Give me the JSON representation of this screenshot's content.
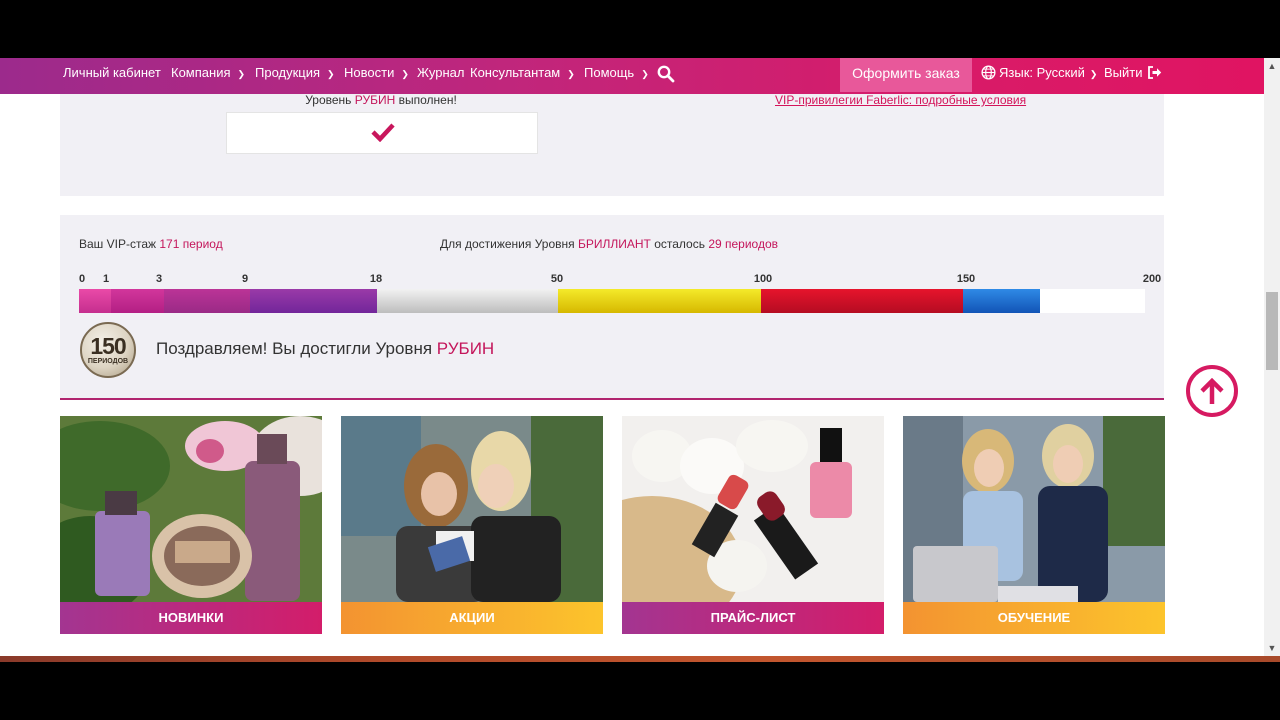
{
  "nav": {
    "items": [
      {
        "label": "Личный кабинет",
        "dropdown": false
      },
      {
        "label": "Компания",
        "dropdown": true
      },
      {
        "label": "Продукция",
        "dropdown": true
      },
      {
        "label": "Новости",
        "dropdown": true
      },
      {
        "label": "Журнал",
        "dropdown": false
      },
      {
        "label": "Консультантам",
        "dropdown": true
      },
      {
        "label": "Помощь",
        "dropdown": true
      }
    ],
    "order_button": "Оформить заказ",
    "language": "Язык: Русский",
    "logout": "Выйти"
  },
  "level_card": {
    "status_prefix": "Уровень ",
    "status_level": "РУБИН",
    "status_suffix": " выполнен!",
    "vip_link": "VIP-привилегии Faberlic: подробные условия"
  },
  "vip": {
    "stage_label": "Ваш VIP-стаж ",
    "stage_value": "171 период",
    "goal_prefix": "Для достижения Уровня ",
    "goal_level": "БРИЛЛИАНТ",
    "goal_middle": " осталось ",
    "goal_remaining": "29 периодов",
    "scale_max": 200,
    "current_periods": 171,
    "ticks": [
      0,
      1,
      3,
      9,
      18,
      50,
      100,
      150,
      200
    ],
    "badge_number": "150",
    "badge_caption": "ПЕРИОДОВ",
    "congrats_text": "Поздравляем! Вы достигли Уровня ",
    "congrats_level": "РУБИН"
  },
  "tiles": [
    {
      "label": "НОВИНКИ"
    },
    {
      "label": "АКЦИИ"
    },
    {
      "label": "ПРАЙС-ЛИСТ"
    },
    {
      "label": "ОБУЧЕНИЕ"
    }
  ],
  "colors": {
    "accent": "#d4145a",
    "nav_gradient_start": "#9c2a8c",
    "nav_gradient_end": "#e01462"
  }
}
